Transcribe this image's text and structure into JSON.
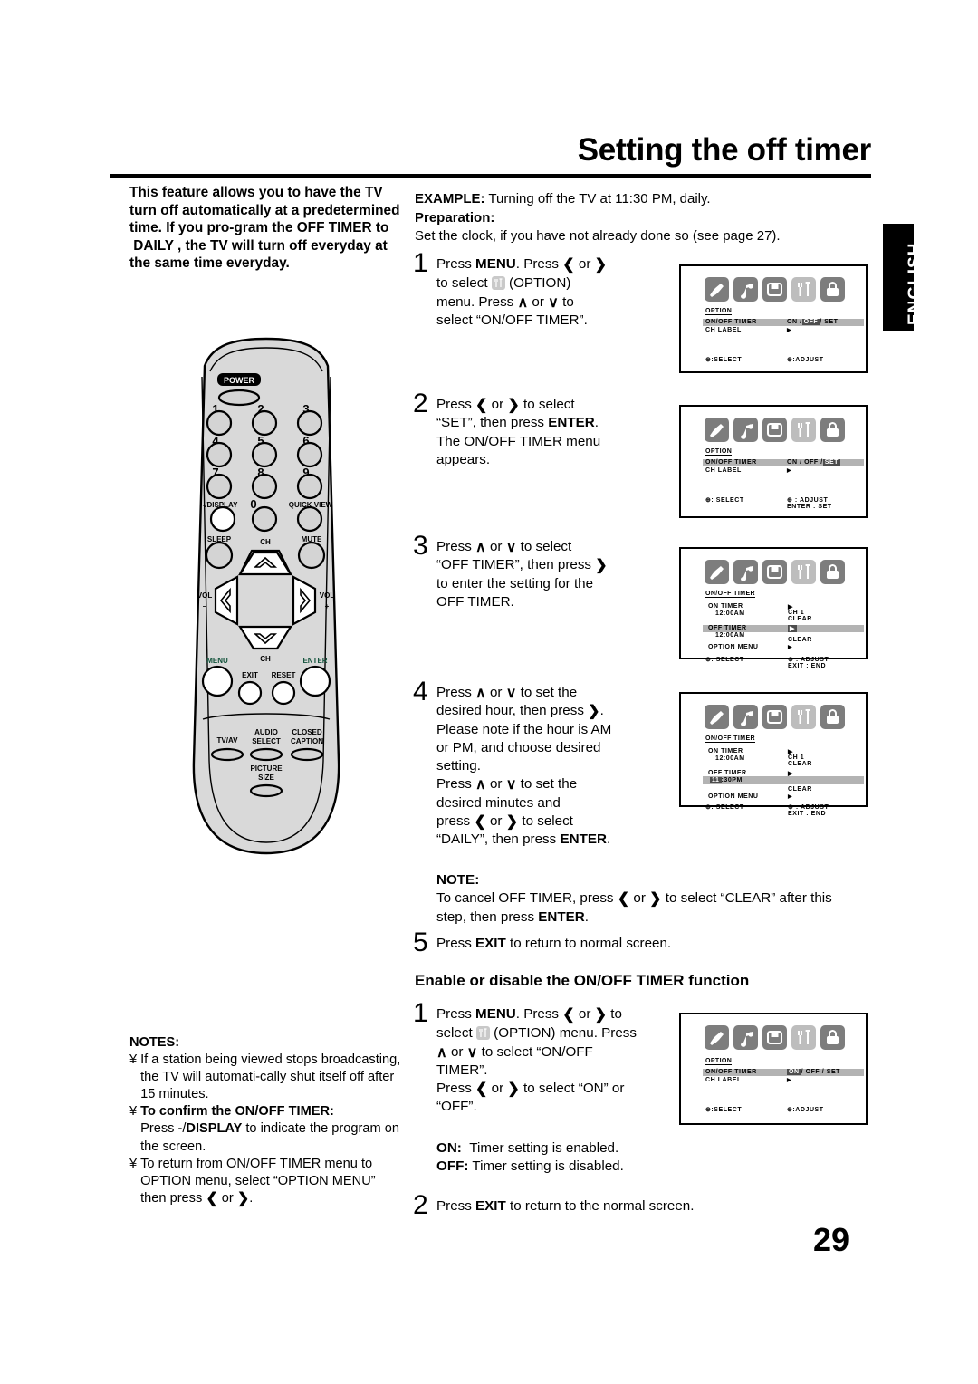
{
  "header": {
    "title": "Setting the off timer",
    "language_tab": "ENGLISH",
    "page_number": "29"
  },
  "intro": {
    "text": "This feature allows you to have the TV turn off automatically at a predetermined time. If you pro-gram the OFF TIMER to  DAILY , the TV will turn off everyday at the same time everyday."
  },
  "example": {
    "label": "EXAMPLE:",
    "text": "Turning off the TV at 11:30 PM, daily.",
    "prep_label": "Preparation:",
    "prep_text": "Set the clock, if you have not already done so (see page 27)."
  },
  "steps": [
    {
      "number": "1",
      "line1_a": "Press ",
      "line1_b": "MENU",
      "line1_c": ". Press ",
      "left": "‹",
      "right": "›",
      "line2": "to select ",
      "line2_b": "(OPTION)",
      "line3": "menu. Press ",
      "up": "∧",
      "down": "∨",
      "line3_b": "to",
      "line4": "select “ON/OFF TIMER”."
    },
    {
      "number": "2",
      "line1": "Press ",
      "line1_b": " to select",
      "line2_a": "“SET”, then press ",
      "line2_b": "ENTER",
      "line2_c": ".",
      "line3": "The ON/OFF TIMER menu",
      "line4": "appears."
    },
    {
      "number": "3",
      "line1_a": "Press ",
      "line1_b": " to select",
      "line2_a": "“OFF TIMER”, then press ",
      "line3": "to enter the setting for the",
      "line4": "OFF TIMER."
    },
    {
      "number": "4",
      "line1_a": "Press ",
      "line1_b": " to set the",
      "line2_a": "desired hour, then press ",
      "line2_b": ".",
      "line3": "Please note if the hour is AM",
      "line4": "or PM, and choose desired",
      "line5": "setting.",
      "line6_a": "Press ",
      "line6_b": " to set the",
      "line7": "desired minutes and",
      "line8_a": "press ",
      "line8_b": " to select",
      "line9_a": "“DAILY”, then press ",
      "line9_b": "ENTER",
      "line9_c": "."
    },
    {
      "number": "5",
      "line1_a": "Press ",
      "line1_b": "EXIT",
      "line1_c": " to return to normal screen."
    }
  ],
  "note": {
    "heading": "NOTE:",
    "line1_a": "To cancel OFF  TIMER, press ",
    "line1_b": " to select “CLEAR” after this",
    "line2_a": "step, then press ",
    "line2_b": "ENTER",
    "line2_c": "."
  },
  "subheading": "Enable or disable the ON/OFF TIMER function",
  "enable_steps": [
    {
      "number": "1",
      "line1_a": "Press ",
      "line1_b": "MENU",
      "line1_c": ". Press ",
      "line1_d": " to",
      "line2_a": "select ",
      "line2_b": "(OPTION) menu. Press",
      "line3_a": " to select “ON/OFF",
      "line4": "TIMER”.",
      "line5_a": "Press ",
      "line5_b": " to select “ON” or",
      "line6": "“OFF”."
    },
    {
      "number": "2",
      "line1_a": "Press ",
      "line1_b": "EXIT",
      "line1_c": " to return to the normal screen."
    }
  ],
  "onoff_definitions": {
    "on_label": "ON:",
    "on_text": "Timer setting is enabled.",
    "off_label": "OFF:",
    "off_text": "Timer setting is disabled."
  },
  "notes": {
    "heading": "NOTES:",
    "bullet_mark": "¥",
    "items": [
      {
        "text": "If a station being viewed stops broadcasting, the TV will automati-cally shut itself off after 15 minutes."
      },
      {
        "bold": "To confirm the ON/OFF TIMER:",
        "pre": "Press -/",
        "bold2": "DISPLAY",
        "post": " to indicate the program on the screen."
      },
      {
        "text": "To return from ON/OFF TIMER menu to OPTION menu, select “OPTION MENU” then press "
      }
    ]
  },
  "remote": {
    "power_label": "POWER",
    "keys": [
      "1",
      "2",
      "3",
      "4",
      "5",
      "6",
      "7",
      "8",
      "9"
    ],
    "display_label": "-/DISPLAY",
    "zero_label": "0",
    "quickview_label": "QUICK VIEW",
    "sleep_label": "SLEEP",
    "mute_label": "MUTE",
    "ch_up_label": "CH",
    "ch_down_label": "CH",
    "vol_minus_label": "VOL",
    "vol_minus_sign": "–",
    "vol_plus_label": "VOL",
    "vol_plus_sign": "+",
    "menu_label": "MENU",
    "enter_label": "ENTER",
    "exit_label": "EXIT",
    "reset_label": "RESET",
    "tvav_label": "TV/AV",
    "audio_select_label": "AUDIO\nSELECT",
    "audio_select_line1": "AUDIO",
    "audio_select_line2": "SELECT",
    "closed_caption_line1": "CLOSED",
    "closed_caption_line2": "CAPTION",
    "picture_size_line1": "PICTURE",
    "picture_size_line2": "SIZE"
  },
  "osd": {
    "icon_names": [
      "picture-icon",
      "audio-icon",
      "setup-icon",
      "option-icon",
      "lock-icon"
    ],
    "screens": [
      {
        "id": "osd-option-off",
        "caption": "OPTION",
        "rows": [
          {
            "label": "ON/OFF TIMER",
            "value_pre": "ON /",
            "value_hl": "OFF",
            "value_post": "/ SET"
          },
          {
            "label": "CH LABEL",
            "value_tri": true
          }
        ],
        "footer_left": "⊕:SELECT",
        "footer_right": "⊕:ADJUST",
        "footer_right2": ""
      },
      {
        "id": "osd-option-set",
        "caption": "OPTION",
        "rows": [
          {
            "label": "ON/OFF TIMER",
            "value_pre": "ON / OFF /",
            "value_hl": "SET",
            "value_post": ""
          },
          {
            "label": "CH LABEL",
            "value_tri": true
          }
        ],
        "footer_left": "⊕: SELECT",
        "footer_right": "⊕ : ADJUST",
        "footer_right2": "ENTER : SET"
      },
      {
        "id": "osd-timer-offtimer",
        "caption": "ON/OFF TIMER",
        "on_timer_label": "ON TIMER",
        "on_timer_value": "12:00AM",
        "on_timer_v1": "▶",
        "on_timer_v2": "CH   1",
        "on_timer_v3": "CLEAR",
        "off_timer_label": "OFF TIMER",
        "off_timer_value": "12:00AM",
        "off_timer_v1_box": true,
        "off_timer_v2": "CLEAR",
        "option_menu_label": "OPTION MENU",
        "footer_left": "⊕: SELECT",
        "footer_right": "⊕ : ADJUST",
        "footer_right2": "EXIT : END"
      },
      {
        "id": "osd-timer-1130pm",
        "caption": "ON/OFF TIMER",
        "on_timer_label": "ON TIMER",
        "on_timer_value": "12:00AM",
        "on_timer_v1": "▶",
        "on_timer_v2": "CH   1",
        "on_timer_v3": "CLEAR",
        "off_timer_label": "OFF TIMER",
        "off_timer_hl": "11",
        "off_timer_rest": ":30PM",
        "off_timer_v1": "▶",
        "off_timer_v2": "CLEAR",
        "option_menu_label": "OPTION MENU",
        "footer_left": "⊕: SELECT",
        "footer_right": "⊕ : ADJUST",
        "footer_right2": "EXIT : END"
      },
      {
        "id": "osd-option-on",
        "caption": "OPTION",
        "rows": [
          {
            "label": "ON/OFF TIMER",
            "value_hl": "ON",
            "value_post": "/ OFF / SET"
          },
          {
            "label": "CH LABEL",
            "value_tri": true
          }
        ],
        "footer_left": "⊕:SELECT",
        "footer_right": "⊕:ADJUST",
        "footer_right2": ""
      }
    ]
  },
  "glyphs": {
    "left_chevron": "‹",
    "right_chevron": "›",
    "up_chevron": "∧",
    "down_chevron": "∨"
  }
}
